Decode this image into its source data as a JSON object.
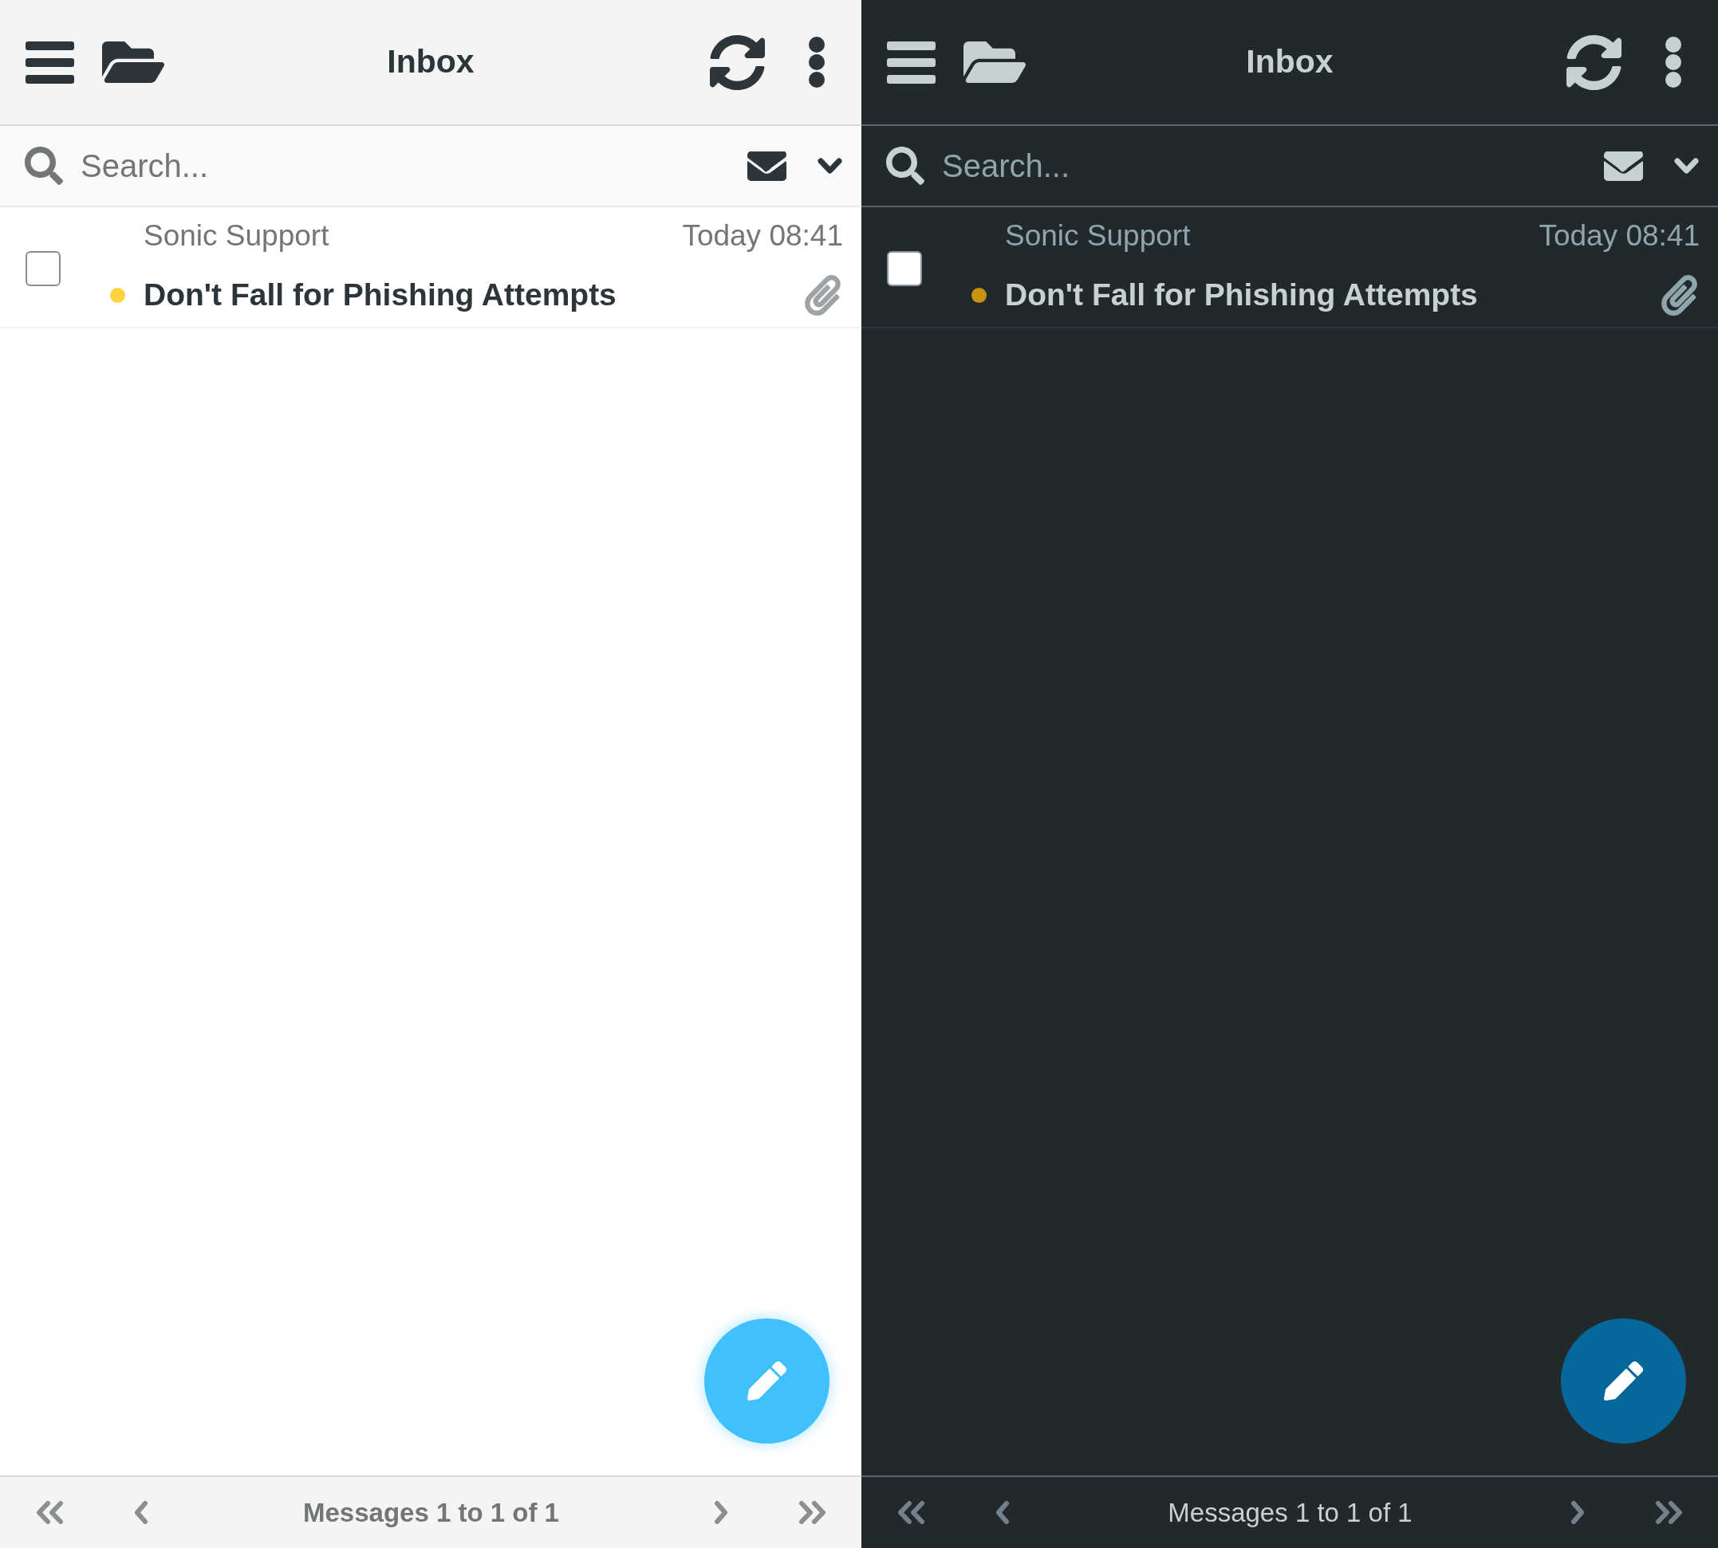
{
  "panels": [
    {
      "kind": "light",
      "header": {
        "title": "Inbox"
      },
      "search": {
        "placeholder": "Search..."
      },
      "messages": [
        {
          "sender": "Sonic Support",
          "date": "Today 08:41",
          "subject": "Don't Fall for Phishing Attempts",
          "checked": false,
          "unread": true,
          "attachment": true
        }
      ],
      "footer": {
        "count": "Messages 1 to 1 of 1"
      }
    },
    {
      "kind": "dark",
      "header": {
        "title": "Inbox"
      },
      "search": {
        "placeholder": "Search..."
      },
      "messages": [
        {
          "sender": "Sonic Support",
          "date": "Today 08:41",
          "subject": "Don't Fall for Phishing Attempts",
          "checked": false,
          "unread": true,
          "attachment": true
        }
      ],
      "footer": {
        "count": "Messages 1 to 1 of 1"
      }
    }
  ]
}
